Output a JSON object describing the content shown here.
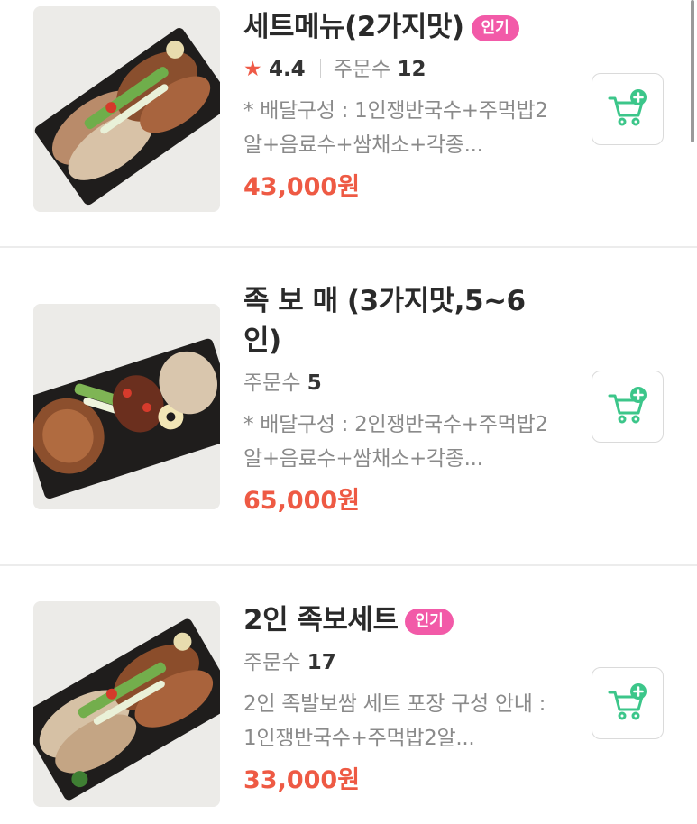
{
  "menu_items": [
    {
      "title": "세트메뉴(2가지맛)",
      "badge": "인기",
      "rating_star": "★",
      "rating": "4.4",
      "orders_label": "주문수",
      "orders": "12",
      "description": "* 배달구성 : 1인쟁반국수+주먹밥2알+음료수+쌈채소+각종...",
      "price": "43,000원",
      "image_icon": "jokbal-platter-image",
      "cart_icon": "cart-plus-icon"
    },
    {
      "title": "족 보 매 (3가지맛,5~6인)",
      "orders_label": "주문수",
      "orders": "5",
      "description": "* 배달구성 : 2인쟁반국수+주먹밥2알+음료수+쌈채소+각종...",
      "price": "65,000원",
      "image_icon": "jokbal-platter-image",
      "cart_icon": "cart-plus-icon"
    },
    {
      "title": "2인 족보세트",
      "badge": "인기",
      "orders_label": "주문수",
      "orders": "17",
      "description": "2인 족발보쌈 세트 포장 구성 안내 : 1인쟁반국수+주먹밥2알...",
      "price": "33,000원",
      "image_icon": "jokbal-platter-image",
      "cart_icon": "cart-plus-icon"
    }
  ],
  "colors": {
    "price": "#ee5a44",
    "badge": "#f25aa8",
    "cart_accent": "#3cc68a",
    "star": "#ef5a47"
  }
}
